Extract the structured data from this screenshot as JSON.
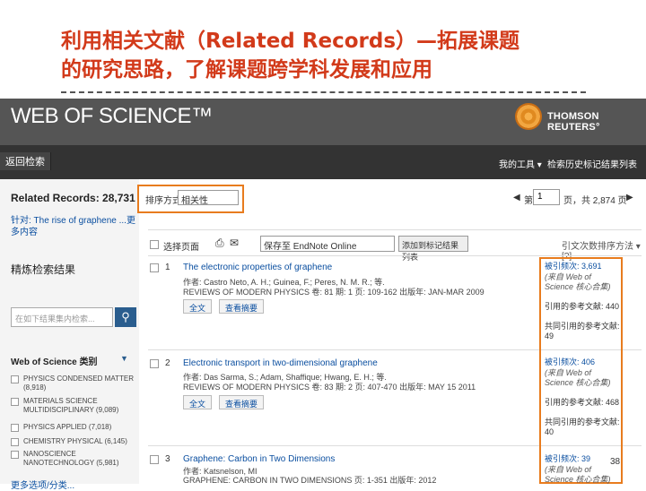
{
  "slide": {
    "title_line1": "利用相关文献（Related Records）—拓展课题",
    "title_line2": "的研究思路，了解课题跨学科发展和应用",
    "page_number": "38"
  },
  "header": {
    "logo": "WEB OF SCIENCE™",
    "brand": "THOMSON REUTERS°"
  },
  "nav": {
    "back": "返回检索",
    "my_tools": "我的工具 ▾",
    "history": "检索历史",
    "marked": "标记结果列表"
  },
  "left": {
    "related_label": "Related Records:",
    "related_count": "28,731",
    "cited_for": "针对: The rise of graphene ...更多内容",
    "refine": "精炼检索结果",
    "search_placeholder": "在如下结果集内检索...",
    "category_head": "Web of Science 类别",
    "categories": [
      "PHYSICS CONDENSED MATTER (8,918)",
      "MATERIALS SCIENCE MULTIDISCIPLINARY (9,089)",
      "PHYSICS APPLIED (7,018)",
      "CHEMISTRY PHYSICAL (6,145)",
      "NANOSCIENCE NANOTECHNOLOGY (5,981)"
    ],
    "more_options": "更多选项/分类..."
  },
  "sort": {
    "label": "排序方式",
    "value": "相关性"
  },
  "pager": {
    "prev": "◀",
    "page_prefix": "第",
    "page_value": "1",
    "page_suffix": "页，共 2,874 页",
    "next": "▶"
  },
  "toolbar": {
    "select_page": "选择页面",
    "print_icon": "⎙",
    "email_icon": "✉",
    "save_to": "保存至 EndNote Online",
    "add_marked": "添加到标记结果列表",
    "col_head": "引文次数排序方法 ▾ [?]"
  },
  "records": [
    {
      "num": "1",
      "title": "The electronic properties of graphene",
      "authors": "作者: Castro Neto, A. H.; Guinea, F.; Peres, N. M. R.; 等.",
      "source": "REVIEWS OF MODERN PHYSICS 卷: 81 期: 1 页: 109-162 出版年: JAN-MAR 2009",
      "btn1": "全文",
      "btn2": "查看摘要",
      "cites": "被引频次: 3,691",
      "cites_note": "(来自 Web of Science 核心合集)",
      "refs": "引用的参考文献: 440",
      "shared": "共同引用的参考文献: 49"
    },
    {
      "num": "2",
      "title": "Electronic transport in two-dimensional graphene",
      "authors": "作者: Das Sarma, S.; Adam, Shaffique; Hwang, E. H.; 等.",
      "source": "REVIEWS OF MODERN PHYSICS 卷: 83 期: 2 页: 407-470 出版年: MAY 15 2011",
      "btn1": "全文",
      "btn2": "查看摘要",
      "cites": "被引频次: 406",
      "cites_note": "(来自 Web of Science 核心合集)",
      "refs": "引用的参考文献: 468",
      "shared": "共同引用的参考文献: 40"
    },
    {
      "num": "3",
      "title": "Graphene: Carbon in Two Dimensions",
      "authors": "作者: Katsnelson, MI",
      "source": "GRAPHENE: CARBON IN TWO DIMENSIONS 页: 1-351 出版年: 2012",
      "cites": "被引频次: 39",
      "cites_note": "(来自 Web of Science 核心合集)"
    }
  ]
}
